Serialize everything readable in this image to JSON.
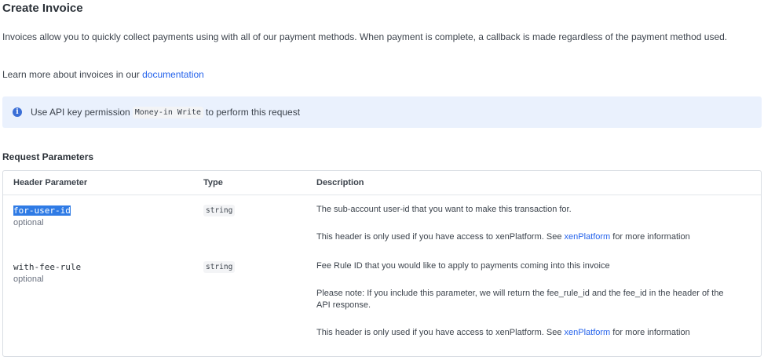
{
  "page": {
    "title": "Create Invoice",
    "intro": "Invoices allow you to quickly collect payments using with all of our payment methods. When payment is complete, a callback is made regardless of the payment method used.",
    "learn_prefix": "Learn more about invoices in our ",
    "learn_link": "documentation"
  },
  "callout": {
    "icon": "info-icon",
    "prefix": "Use API key permission",
    "permission": "Money-in Write",
    "suffix": "to perform this request"
  },
  "request": {
    "heading": "Request Parameters",
    "columns": [
      "Header Parameter",
      "Type",
      "Description"
    ],
    "rows": [
      {
        "name": "for-user-id",
        "optional": "optional",
        "type": "string",
        "desc1": "The sub-account user-id that you want to make this transaction for.",
        "desc2_prefix": "This header is only used if you have access to xenPlatform. See ",
        "desc2_link": "xenPlatform",
        "desc2_suffix": " for more information"
      },
      {
        "name": "with-fee-rule",
        "optional": "optional",
        "type": "string",
        "desc1": "Fee Rule ID that you would like to apply to payments coming into this invoice",
        "desc2": "Please note: If you include this parameter, we will return the fee_rule_id and the fee_id in the header of the API response.",
        "desc3_prefix": "This header is only used if you have access to xenPlatform. See ",
        "desc3_link": "xenPlatform",
        "desc3_suffix": " for more information"
      }
    ]
  },
  "colors": {
    "link": "#2563eb",
    "callout_bg": "#eaf1fd",
    "selection": "#2f7be5"
  }
}
